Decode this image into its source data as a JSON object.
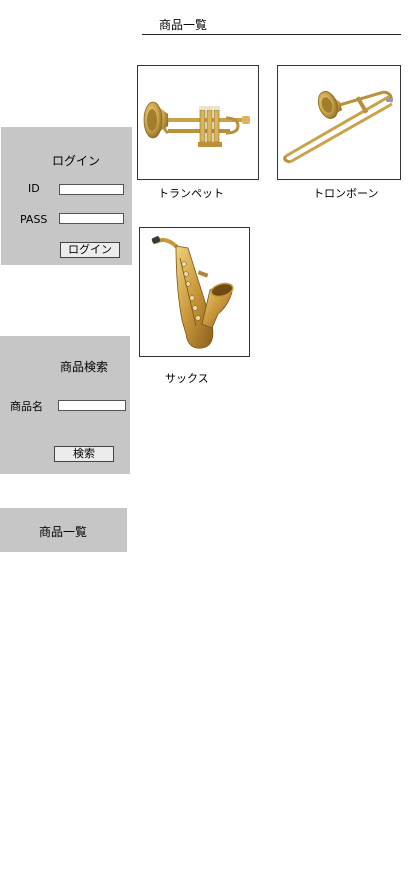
{
  "main": {
    "title": "商品一覧",
    "products": [
      {
        "name": "トランペット",
        "image_icon": "trumpet-image"
      },
      {
        "name": "トロンボーン",
        "image_icon": "trombone-image"
      },
      {
        "name": "サックス",
        "image_icon": "saxophone-image"
      }
    ]
  },
  "login": {
    "title": "ログイン",
    "id_label": "ID",
    "pass_label": "PASS",
    "id_value": "",
    "pass_value": "",
    "button_label": "ログイン"
  },
  "search": {
    "title": "商品検索",
    "name_label": "商品名",
    "name_value": "",
    "button_label": "検索"
  },
  "product_list_link": {
    "label": "商品一覧"
  },
  "colors": {
    "panel_bg": "#c6c6c6",
    "brass": "#c9a24a"
  }
}
